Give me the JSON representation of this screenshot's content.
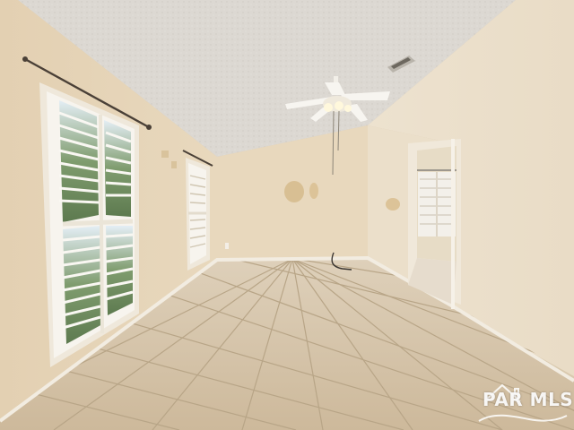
{
  "photo": {
    "subject": "empty-room-interior",
    "elements": [
      "textured-ceiling",
      "ceiling-fan",
      "air-vent",
      "plantation-shutter-windows",
      "tile-floor",
      "doorway",
      "baseboards",
      "outlet"
    ]
  },
  "watermark": {
    "text": "PAR MLS",
    "color": "#ffffff"
  },
  "colors": {
    "ceiling": "#ddd9d3",
    "walls": "#e6d6bb",
    "floor_tile": "#d5c3a8",
    "grout": "#b8a587",
    "shutters": "#f4f1ea"
  }
}
